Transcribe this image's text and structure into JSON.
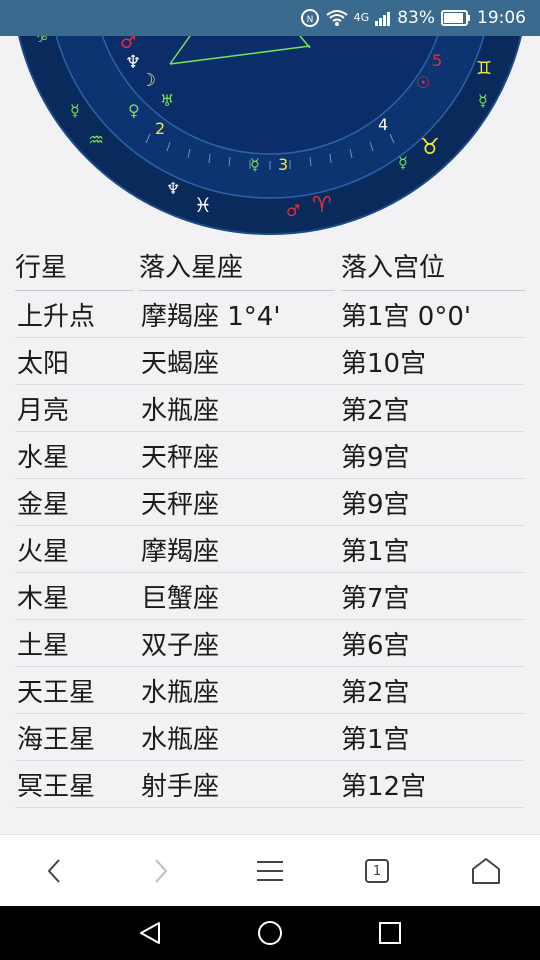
{
  "status_bar": {
    "network": "4G",
    "battery_percent": "83%",
    "time": "19:06"
  },
  "chart": {
    "house_numbers": [
      "2",
      "3",
      "4",
      "5"
    ],
    "colors": {
      "outer": "#0a2a5c",
      "ring": "#123a7a",
      "inner": "#0b2e6a",
      "accent_green": "#7be05a",
      "accent_red": "#e0303a",
      "accent_yellow": "#f2e63a"
    }
  },
  "table": {
    "headers": [
      "行星",
      "落入星座",
      "落入宫位"
    ],
    "rows": [
      {
        "planet": "上升点",
        "sign": "摩羯座 1°4'",
        "house": "第1宫 0°0'"
      },
      {
        "planet": "太阳",
        "sign": "天蝎座",
        "house": "第10宫"
      },
      {
        "planet": "月亮",
        "sign": "水瓶座",
        "house": "第2宫"
      },
      {
        "planet": "水星",
        "sign": "天秤座",
        "house": "第9宫"
      },
      {
        "planet": "金星",
        "sign": "天秤座",
        "house": "第9宫"
      },
      {
        "planet": "火星",
        "sign": "摩羯座",
        "house": "第1宫"
      },
      {
        "planet": "木星",
        "sign": "巨蟹座",
        "house": "第7宫"
      },
      {
        "planet": "土星",
        "sign": "双子座",
        "house": "第6宫"
      },
      {
        "planet": "天王星",
        "sign": "水瓶座",
        "house": "第2宫"
      },
      {
        "planet": "海王星",
        "sign": "水瓶座",
        "house": "第1宫"
      },
      {
        "planet": "冥王星",
        "sign": "射手座",
        "house": "第12宫"
      }
    ]
  },
  "browser_nav": {
    "tab_count": "1"
  }
}
